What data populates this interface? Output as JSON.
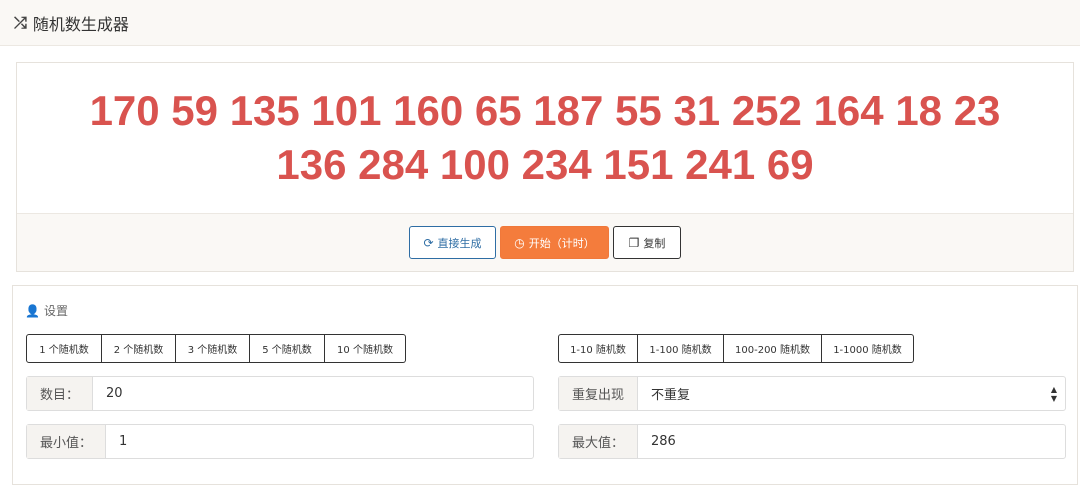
{
  "header": {
    "icon": "shuffle-icon",
    "title": "随机数生成器"
  },
  "result": {
    "numbers_line1": "170 59 135 101 160 65 187 55 31 252 164 18 23",
    "numbers_line2": "136 284 100 234 151 241 69"
  },
  "actions": {
    "direct_label": "直接生成",
    "start_label": "开始（计时）",
    "copy_label": "复制"
  },
  "settings": {
    "title": "设置",
    "count_presets": [
      "1 个随机数",
      "2 个随机数",
      "3 个随机数",
      "5 个随机数",
      "10 个随机数"
    ],
    "range_presets": [
      "1-10 随机数",
      "1-100 随机数",
      "100-200 随机数",
      "1-1000 随机数"
    ],
    "count_label": "数目：",
    "count_value": "20",
    "repeat_label": "重复出现",
    "repeat_value": "不重复",
    "min_label": "最小值：",
    "min_value": "1",
    "max_label": "最大值：",
    "max_value": "286"
  },
  "colors": {
    "numbers": "#d9534f",
    "start_button": "#f47c3c",
    "direct_button": "#2e6da4"
  }
}
